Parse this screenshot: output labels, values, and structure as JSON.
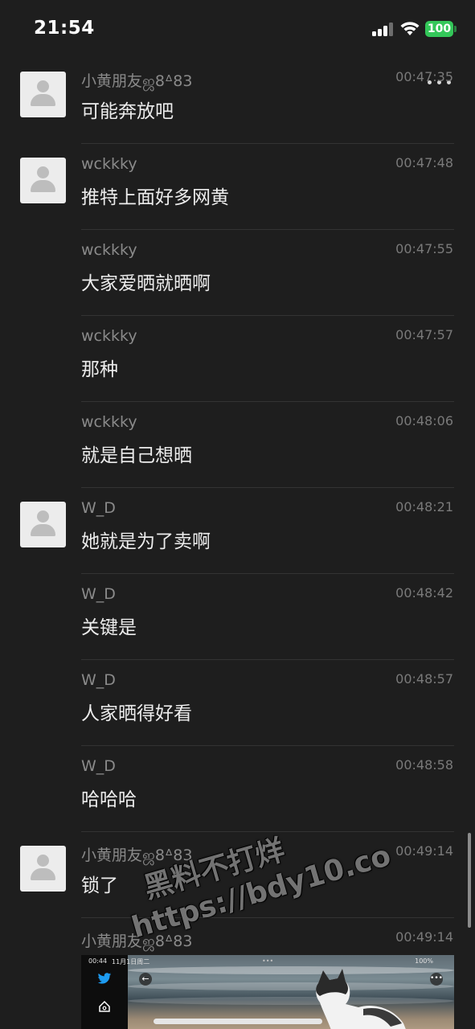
{
  "status_bar": {
    "time": "21:54",
    "battery": "100",
    "battery_color": "#33c759"
  },
  "nav": {
    "back_icon": "chevron-left-icon",
    "more_icon": "ellipsis-icon"
  },
  "messages": [
    {
      "sender": "小黄朋友ஜ8ᐞ83",
      "time": "00:47:35",
      "text": "可能奔放吧",
      "avatar": true
    },
    {
      "sender": "wckkky",
      "time": "00:47:48",
      "text": "推特上面好多网黄",
      "avatar": true
    },
    {
      "sender": "wckkky",
      "time": "00:47:55",
      "text": "大家爱晒就晒啊",
      "avatar": false
    },
    {
      "sender": "wckkky",
      "time": "00:47:57",
      "text": "那种",
      "avatar": false
    },
    {
      "sender": "wckkky",
      "time": "00:48:06",
      "text": "就是自己想晒",
      "avatar": false
    },
    {
      "sender": "W_D",
      "time": "00:48:21",
      "text": "她就是为了卖啊",
      "avatar": true
    },
    {
      "sender": "W_D",
      "time": "00:48:42",
      "text": "关键是",
      "avatar": false
    },
    {
      "sender": "W_D",
      "time": "00:48:57",
      "text": "人家晒得好看",
      "avatar": false
    },
    {
      "sender": "W_D",
      "time": "00:48:58",
      "text": "哈哈哈",
      "avatar": false
    },
    {
      "sender": "小黄朋友ஜ8ᐞ83",
      "time": "00:49:14",
      "text": "锁了",
      "avatar": true
    }
  ],
  "image_message": {
    "sender": "小黄朋友ஜ8ᐞ83",
    "time": "00:49:14",
    "preview": {
      "status_time": "00:44",
      "status_date": "11月1日周二",
      "status_battery": "100%",
      "dots": "•••",
      "back_glyph": "←",
      "more_glyph": "•••"
    }
  },
  "watermark": {
    "line1": "黑料不打烊",
    "line2": "https://bdy10.co"
  }
}
